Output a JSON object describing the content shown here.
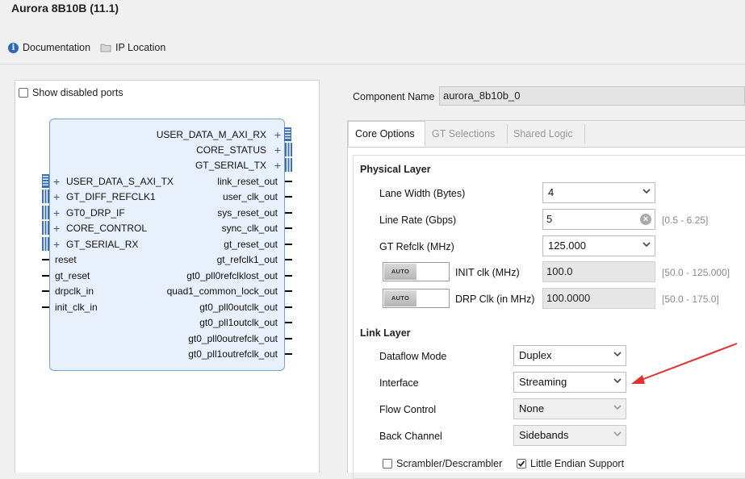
{
  "window": {
    "title": "Aurora 8B10B (11.1)"
  },
  "toolbar": {
    "documentation_label": "Documentation",
    "ip_location_label": "IP Location"
  },
  "symbol_panel": {
    "show_disabled_ports_label": "Show disabled ports",
    "right_pins": [
      "USER_DATA_M_AXI_RX",
      "CORE_STATUS",
      "GT_SERIAL_TX",
      "link_reset_out",
      "user_clk_out",
      "sys_reset_out",
      "sync_clk_out",
      "gt_reset_out",
      "gt_refclk1_out",
      "gt0_pll0refclklost_out",
      "quad1_common_lock_out",
      "gt0_pll0outclk_out",
      "gt0_pll1outclk_out",
      "gt0_pll0outrefclk_out",
      "gt0_pll1outrefclk_out"
    ],
    "left_pins": [
      "USER_DATA_S_AXI_TX",
      "GT_DIFF_REFCLK1",
      "GT0_DRP_IF",
      "CORE_CONTROL",
      "GT_SERIAL_RX",
      "reset",
      "gt_reset",
      "drpclk_in",
      "init_clk_in"
    ]
  },
  "component": {
    "label": "Component Name",
    "value": "aurora_8b10b_0"
  },
  "tabs": [
    {
      "label": "Core Options"
    },
    {
      "label": "GT Selections"
    },
    {
      "label": "Shared Logic"
    }
  ],
  "physical_layer": {
    "title": "Physical Layer",
    "lane_width": {
      "label": "Lane Width (Bytes)",
      "value": "4"
    },
    "line_rate": {
      "label": "Line Rate (Gbps)",
      "value": "5",
      "range": "[0.5 - 6.25]"
    },
    "gt_refclk": {
      "label": "GT Refclk (MHz)",
      "value": "125.000"
    },
    "init_clk": {
      "toggle": "AUTO",
      "label": "INIT clk (MHz)",
      "value": "100.0",
      "range": "[50.0 - 125.000]"
    },
    "drp_clk": {
      "toggle": "AUTO",
      "label": "DRP Clk (in MHz)",
      "value": "100.0000",
      "range": "[50.0 - 175.0]"
    }
  },
  "link_layer": {
    "title": "Link Layer",
    "dataflow_mode": {
      "label": "Dataflow Mode",
      "value": "Duplex"
    },
    "interface": {
      "label": "Interface",
      "value": "Streaming"
    },
    "flow_control": {
      "label": "Flow Control",
      "value": "None"
    },
    "back_channel": {
      "label": "Back Channel",
      "value": "Sidebands"
    },
    "scrambler": {
      "label": "Scrambler/Descrambler",
      "checked": false
    },
    "little_endian": {
      "label": "Little Endian Support",
      "checked": true
    }
  },
  "annotation": {
    "arrow_color": "#e03030"
  }
}
